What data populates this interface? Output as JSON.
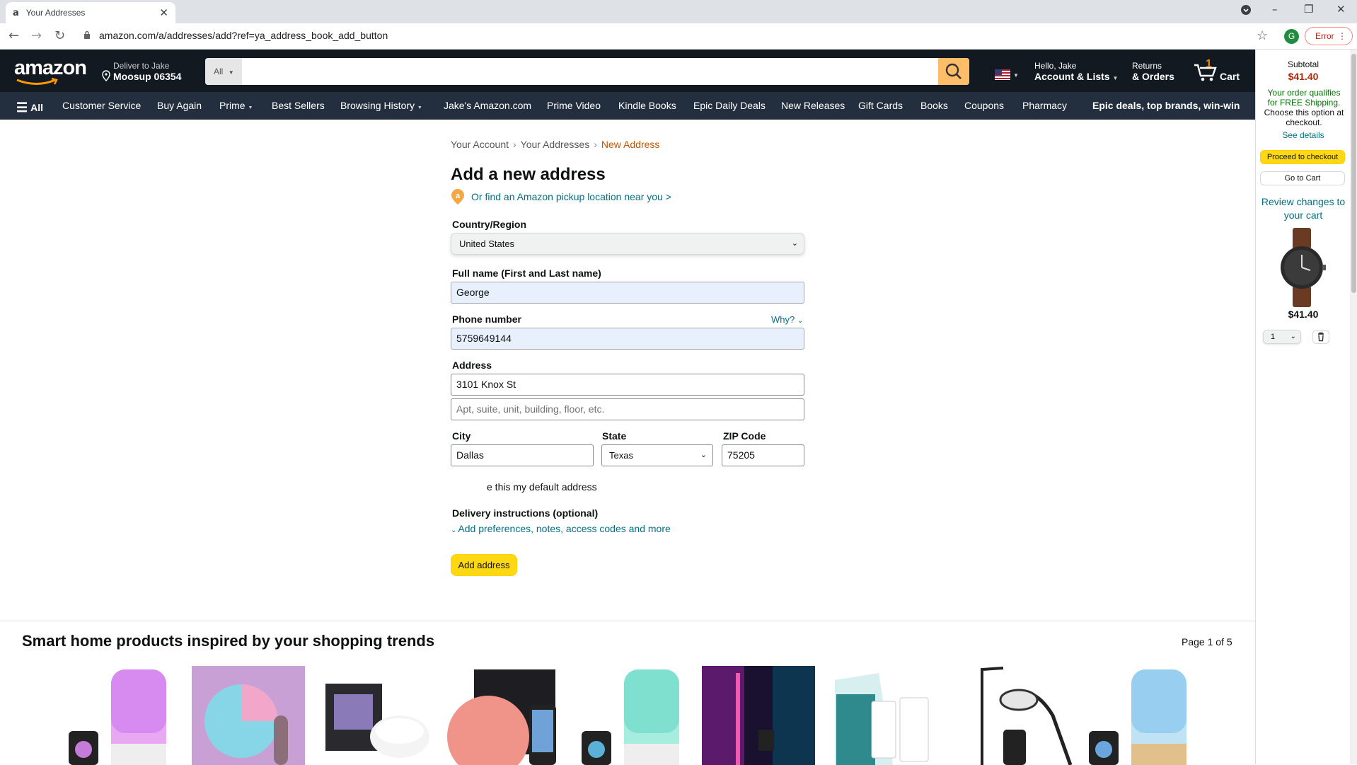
{
  "browser": {
    "tab_title": "Your Addresses",
    "tab_favicon": "a",
    "url": "amazon.com/a/addresses/add?ref=ya_address_book_add_button",
    "profile_initial": "G",
    "error_label": "Error"
  },
  "header": {
    "logo": "amazon",
    "deliver_line1": "Deliver to Jake",
    "deliver_line2": "Moosup 06354",
    "search_category": "All",
    "search_value": "",
    "account_line1": "Hello, Jake",
    "account_line2": "Account & Lists",
    "returns_line1": "Returns",
    "returns_line2": "& Orders",
    "cart_count": "1",
    "cart_label": "Cart"
  },
  "nav": {
    "all": "All",
    "items": [
      "Customer Service",
      "Buy Again",
      "Prime",
      "Best Sellers",
      "Browsing History",
      "Jake's Amazon.com",
      "Prime Video",
      "Kindle Books",
      "Epic Daily Deals",
      "New Releases",
      "Gift Cards",
      "Books",
      "Coupons",
      "Pharmacy"
    ],
    "promo": "Epic deals, top brands, win-win"
  },
  "breadcrumb": {
    "item1": "Your Account",
    "item2": "Your Addresses",
    "current": "New Address",
    "separator": "›"
  },
  "form": {
    "title": "Add a new address",
    "pickup_link": "Or find an Amazon pickup location near you >",
    "country_label": "Country/Region",
    "country_value": "United States",
    "fullname_label": "Full name (First and Last name)",
    "fullname_value": "George",
    "phone_label": "Phone number",
    "phone_value": "5759649144",
    "why_label": "Why?",
    "address_label": "Address",
    "address_line1_value": "3101 Knox St",
    "address_line2_placeholder": "Apt, suite, unit, building, floor, etc.",
    "city_label": "City",
    "city_value": "Dallas",
    "state_label": "State",
    "state_value": "Texas",
    "zip_label": "ZIP Code",
    "zip_value": "75205",
    "default_text": "e this my default address",
    "delivery_label": "Delivery instructions (optional)",
    "preferences_link": "Add preferences, notes, access codes and more",
    "submit_label": "Add address"
  },
  "recommendations": {
    "title": "Smart home products inspired by your shopping trends",
    "page": "Page 1 of 5"
  },
  "cart_panel": {
    "subtotal_label": "Subtotal",
    "subtotal_amount": "$41.40",
    "free_shipping": "Your order qualifies for FREE Shipping.",
    "choose_option": "Choose this option at checkout.",
    "see_details": "See details",
    "checkout_label": "Proceed to checkout",
    "go_to_cart": "Go to Cart",
    "review_changes": "Review changes to your cart",
    "item_price": "$41.40",
    "item_qty": "1"
  },
  "colors": {
    "header_bg": "#131921",
    "nav_bg": "#232f3e",
    "search_button": "#febd69",
    "primary_button": "#ffd814",
    "link": "#007185",
    "price_red": "#b12704"
  }
}
